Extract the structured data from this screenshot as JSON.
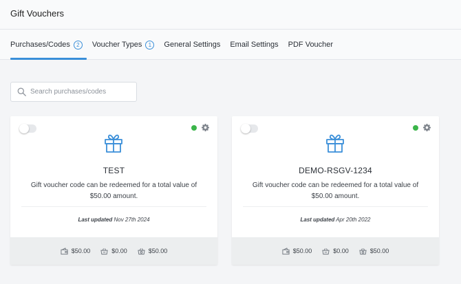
{
  "header": {
    "title": "Gift Vouchers"
  },
  "tabs": [
    {
      "label": "Purchases/Codes",
      "count": "2",
      "active": true
    },
    {
      "label": "Voucher Types",
      "count": "1",
      "active": false
    },
    {
      "label": "General Settings",
      "count": "",
      "active": false
    },
    {
      "label": "Email Settings",
      "count": "",
      "active": false
    },
    {
      "label": "PDF Voucher",
      "count": "",
      "active": false
    }
  ],
  "search": {
    "placeholder": "Search purchases/codes",
    "value": ""
  },
  "colors": {
    "accent": "#3a8fd9",
    "status_active": "#3bb54a",
    "gift_icon": "#3a8fd9"
  },
  "cards": [
    {
      "code": "TEST",
      "description": "Gift voucher code can be redeemed for a total value of $50.00 amount.",
      "last_updated_label": "Last updated",
      "last_updated_date": "Nov 27th 2024",
      "total": "$50.00",
      "redeemed": "$0.00",
      "remaining": "$50.00",
      "status_icon": "status-dot",
      "toggle_on": false
    },
    {
      "code": "DEMO-RSGV-1234",
      "description": "Gift voucher code can be redeemed for a total value of $50.00 amount.",
      "last_updated_label": "Last updated",
      "last_updated_date": "Apr 20th 2022",
      "total": "$50.00",
      "redeemed": "$0.00",
      "remaining": "$50.00",
      "status_icon": "status-dot",
      "toggle_on": false
    }
  ]
}
